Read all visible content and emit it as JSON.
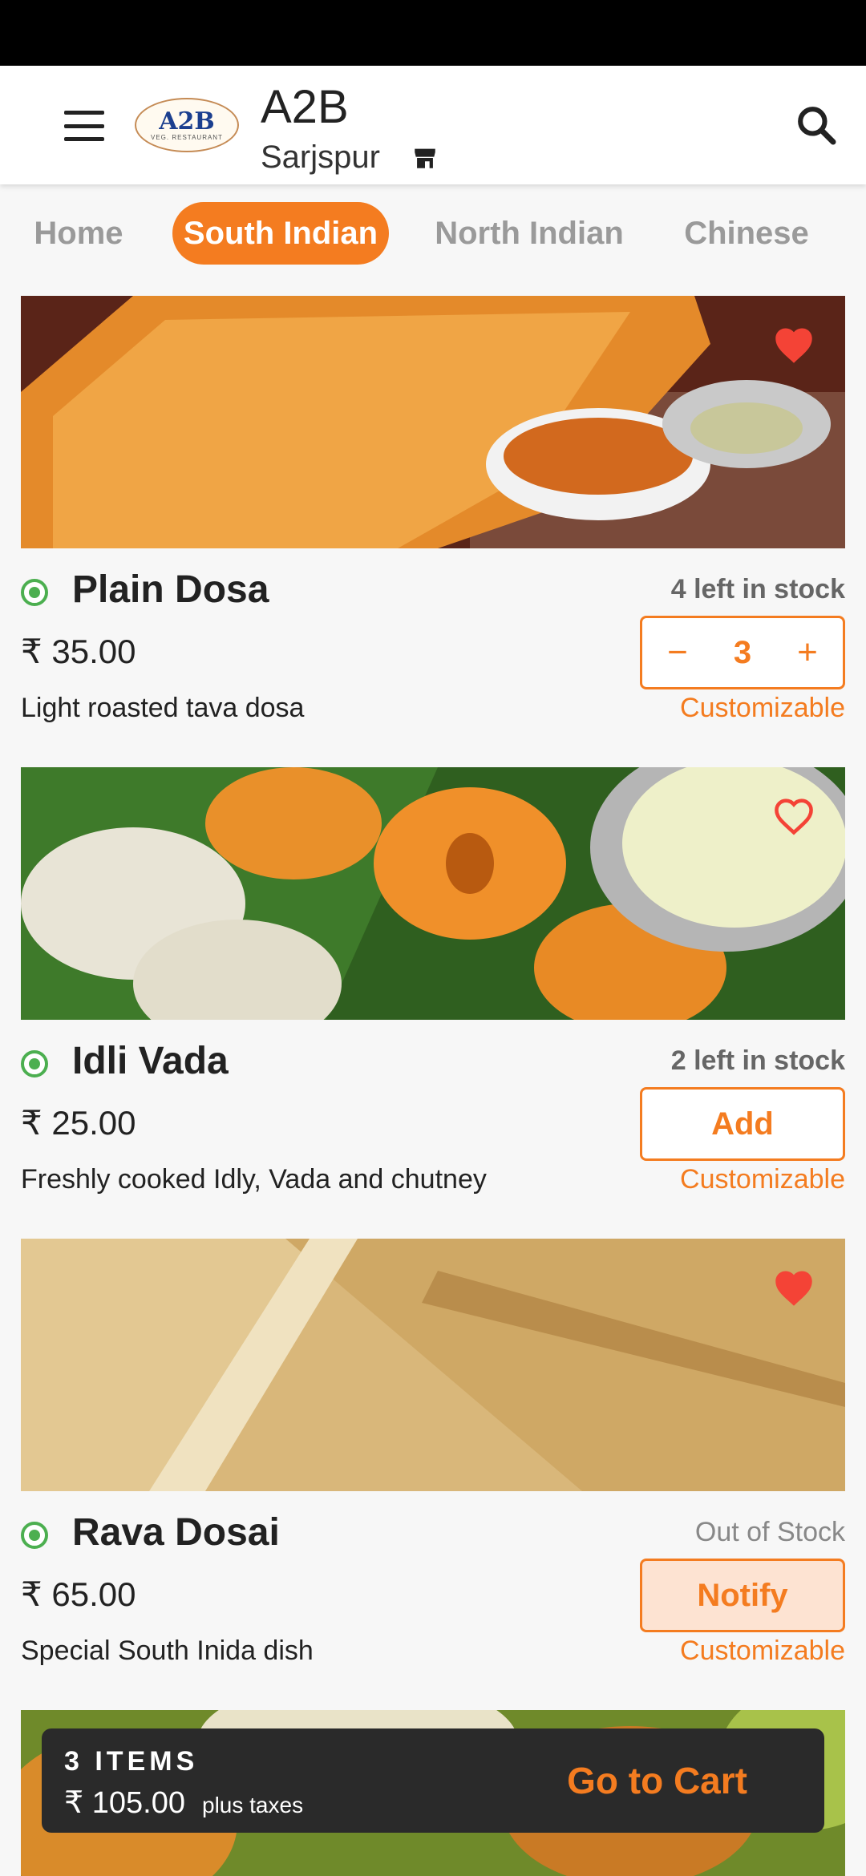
{
  "header": {
    "title": "A2B",
    "location": "Sarjspur",
    "logo_text": "A2B",
    "logo_subtext": "VEG. RESTAURANT"
  },
  "tabs": [
    {
      "label": "Home",
      "active": false
    },
    {
      "label": "South Indian",
      "active": true
    },
    {
      "label": "North Indian",
      "active": false
    },
    {
      "label": "Chinese",
      "active": false
    }
  ],
  "items": [
    {
      "name": "Plain Dosa",
      "price": "₹ 35.00",
      "description": "Light roasted tava dosa",
      "stock": "4 left in stock",
      "quantity": "3",
      "customizable": "Customizable",
      "favorite": true
    },
    {
      "name": "Idli Vada",
      "price": "₹ 25.00",
      "description": "Freshly cooked Idly, Vada and chutney",
      "stock": "2 left in stock",
      "action_label": "Add",
      "customizable": "Customizable",
      "favorite": false
    },
    {
      "name": "Rava Dosai",
      "price": "₹ 65.00",
      "description": "Special South Inida dish",
      "stock": "Out of Stock",
      "action_label": "Notify",
      "customizable": "Customizable",
      "favorite": true
    }
  ],
  "stepper": {
    "minus": "−",
    "plus": "+"
  },
  "cart": {
    "count_label": "3 ITEMS",
    "total": "₹ 105.00",
    "taxes_note": "plus taxes",
    "button_label": "Go to Cart"
  },
  "colors": {
    "accent": "#f47c20",
    "favorite": "#f44336",
    "veg": "#4caf50",
    "cart_bg": "#2a2a2a"
  }
}
